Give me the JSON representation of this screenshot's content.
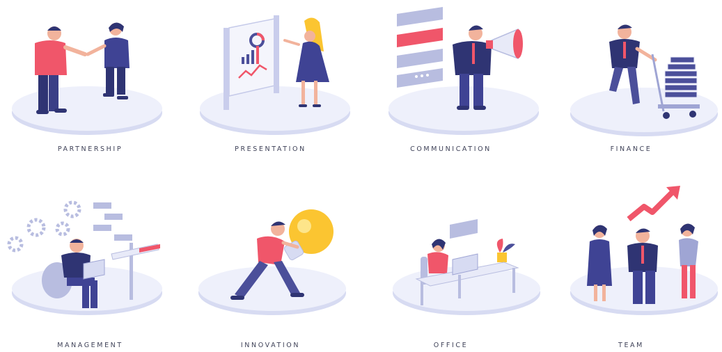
{
  "palette": {
    "navy": "#2f3473",
    "indigo": "#4b4f9a",
    "coral": "#f0566a",
    "skin": "#f2b39c",
    "platform": "#eef0fb",
    "platform_edge": "#d7dbf2",
    "yellow": "#fbc531",
    "grey_blue": "#b8bde0"
  },
  "items": [
    {
      "label": "PARTNERSHIP",
      "icon": "handshake-icon"
    },
    {
      "label": "PRESENTATION",
      "icon": "presentation-board-icon"
    },
    {
      "label": "COMMUNICATION",
      "icon": "megaphone-icon"
    },
    {
      "label": "FINANCE",
      "icon": "money-cart-icon"
    },
    {
      "label": "MANAGEMENT",
      "icon": "gears-laptop-icon"
    },
    {
      "label": "INNOVATION",
      "icon": "lightbulb-icon"
    },
    {
      "label": "OFFICE",
      "icon": "desk-icon"
    },
    {
      "label": "TEAM",
      "icon": "team-growth-icon"
    }
  ]
}
